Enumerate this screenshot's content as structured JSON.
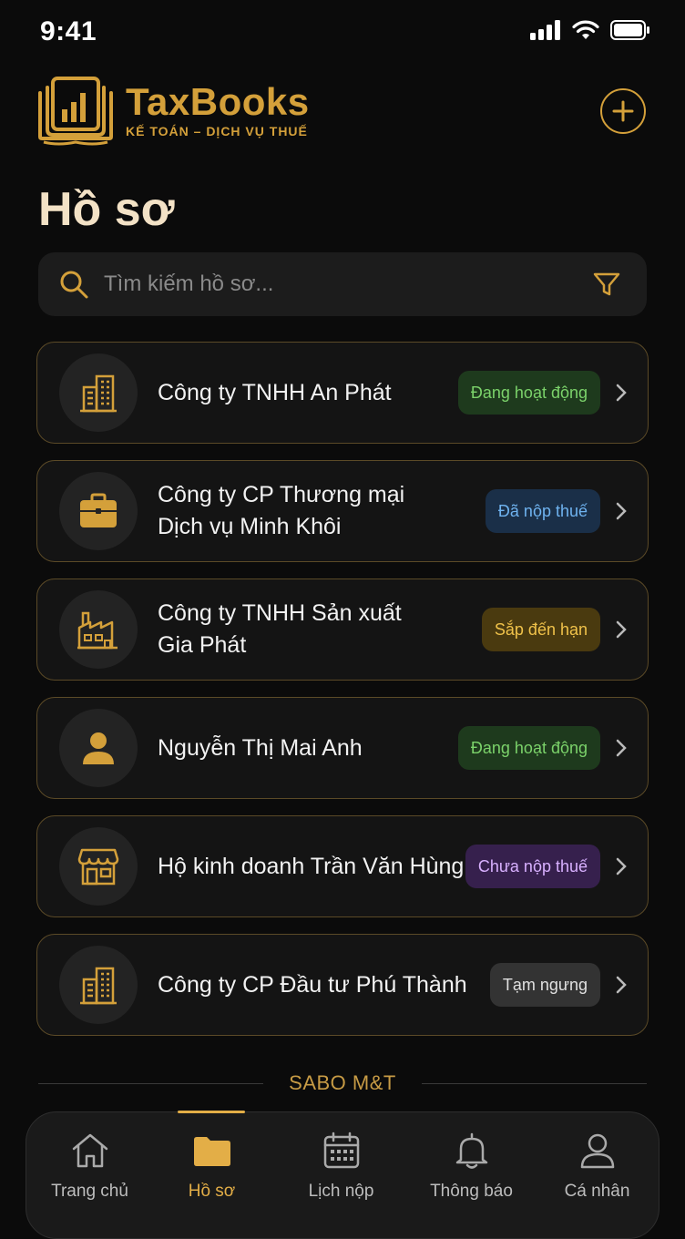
{
  "status_bar": {
    "time": "9:41"
  },
  "brand": {
    "name": "TaxBooks",
    "tagline": "KẾ TOÁN – DỊCH VỤ THUẾ"
  },
  "header": {
    "add_icon": "plus-circle-icon"
  },
  "page": {
    "title": "Hồ sơ"
  },
  "search": {
    "placeholder": "Tìm kiếm hồ sơ...",
    "value": ""
  },
  "profiles": [
    {
      "name": "Công ty TNHH An Phát",
      "icon": "office-building-icon",
      "status": "Đang hoạt động",
      "status_color": "#7bd26a"
    },
    {
      "name": "Công ty CP Thương mại Dịch vụ Minh Khôi",
      "name_line1": "Công ty CP Thương mại",
      "name_line2": "Dịch vụ Minh Khôi",
      "icon": "briefcase-icon",
      "status": "Đã nộp thuế",
      "status_color": "#6fb3f0"
    },
    {
      "name": "Công ty TNHH Sản xuất Gia Phát",
      "name_line1": "Công ty TNHH Sản xuất",
      "name_line2": "Gia Phát",
      "icon": "factory-icon",
      "status": "Sắp đến hạn",
      "status_color": "#f0c24a"
    },
    {
      "name": "Nguyễn Thị Mai Anh",
      "icon": "person-icon",
      "status": "Đang hoạt động",
      "status_color": "#7bd26a"
    },
    {
      "name": "Hộ kinh doanh Trần Văn Hùng",
      "icon": "storefront-icon",
      "status": "Chưa nộp thuế",
      "status_color": "#d8b0ff"
    },
    {
      "name": "Công ty CP Đầu tư Phú Thành",
      "icon": "office-building-icon",
      "status": "Tạm ngưng",
      "status_color": "#e0e0e0"
    }
  ],
  "footer": {
    "text": "SABO M&T"
  },
  "tabs": [
    {
      "label": "Trang chủ",
      "icon": "home-icon",
      "active": false
    },
    {
      "label": "Hồ sơ",
      "icon": "folder-icon",
      "active": true
    },
    {
      "label": "Lịch nộp",
      "icon": "calendar-icon",
      "active": false
    },
    {
      "label": "Thông báo",
      "icon": "bell-icon",
      "active": false
    },
    {
      "label": "Cá nhân",
      "icon": "user-icon",
      "active": false
    }
  ],
  "colors": {
    "accent": "#d4a03a",
    "background": "#0b0b0b",
    "card": "#141414",
    "card_border": "#5b4a27"
  }
}
